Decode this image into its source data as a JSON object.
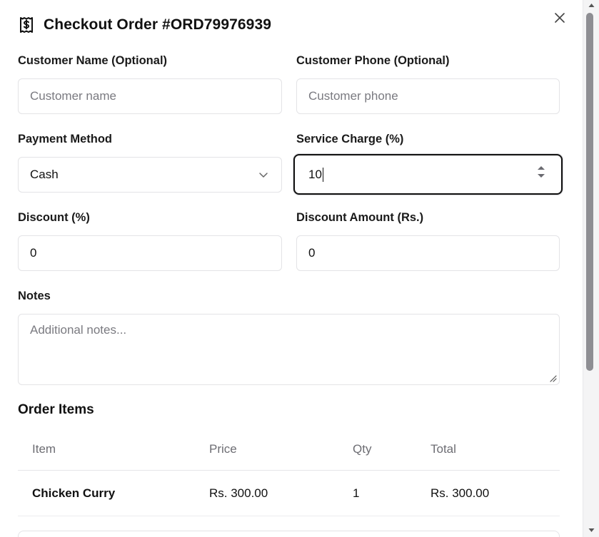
{
  "dialog": {
    "title": "Checkout Order #ORD79976939",
    "title_icon": "receipt-dollar-icon",
    "close_icon": "close-icon"
  },
  "form": {
    "customer_name": {
      "label": "Customer Name (Optional)",
      "placeholder": "Customer name",
      "value": ""
    },
    "customer_phone": {
      "label": "Customer Phone (Optional)",
      "placeholder": "Customer phone",
      "value": ""
    },
    "payment_method": {
      "label": "Payment Method",
      "value": "Cash"
    },
    "service_charge": {
      "label": "Service Charge (%)",
      "value": "10"
    },
    "discount_percent": {
      "label": "Discount (%)",
      "value": "0"
    },
    "discount_amount": {
      "label": "Discount Amount (Rs.)",
      "value": "0"
    },
    "notes": {
      "label": "Notes",
      "placeholder": "Additional notes...",
      "value": ""
    }
  },
  "order_items": {
    "title": "Order Items",
    "columns": [
      "Item",
      "Price",
      "Qty",
      "Total"
    ],
    "rows": [
      {
        "item": "Chicken Curry",
        "price": "Rs. 300.00",
        "qty": "1",
        "total": "Rs. 300.00"
      }
    ]
  }
}
